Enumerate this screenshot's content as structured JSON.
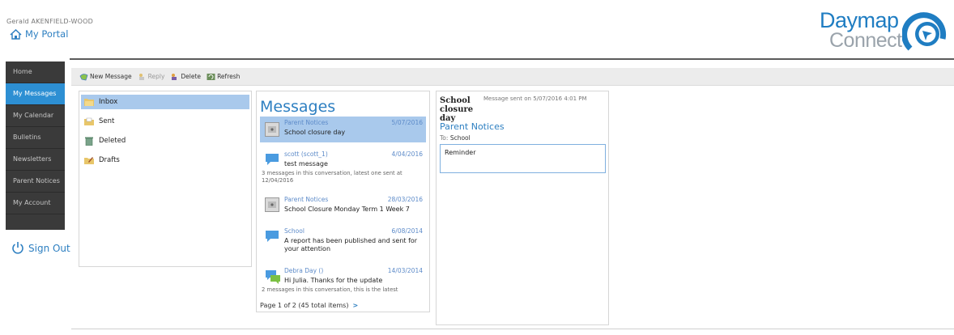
{
  "header": {
    "user_name": "Gerald AKENFIELD-WOOD",
    "portal_label": "My Portal",
    "brand_word1": "Daymap",
    "brand_word2": "Connect",
    "brand_color": "#1f7dc2"
  },
  "sidebar": {
    "items": [
      {
        "label": "Home",
        "active": false
      },
      {
        "label": "My Messages",
        "active": true
      },
      {
        "label": "My Calendar",
        "active": false
      },
      {
        "label": "Bulletins",
        "active": false
      },
      {
        "label": "Newsletters",
        "active": false
      },
      {
        "label": "Parent Notices",
        "active": false
      },
      {
        "label": "My Account",
        "active": false
      }
    ],
    "signout_label": "Sign Out",
    "active_color": "#2d8fd3"
  },
  "toolbar": {
    "new_message": "New Message",
    "reply": "Reply",
    "delete": "Delete",
    "refresh": "Refresh"
  },
  "folders": [
    {
      "label": "Inbox",
      "icon": "inbox-folder-icon"
    },
    {
      "label": "Sent",
      "icon": "sent-folder-icon"
    },
    {
      "label": "Deleted",
      "icon": "deleted-folder-icon"
    },
    {
      "label": "Drafts",
      "icon": "drafts-folder-icon"
    }
  ],
  "messages": {
    "title": "Messages",
    "items": [
      {
        "sender": "Parent Notices",
        "date": "5/07/2016",
        "subject": "School closure day",
        "meta": "",
        "icon": "notice-icon"
      },
      {
        "sender": "scott (scott_1)",
        "date": "4/04/2016",
        "subject": "test message",
        "meta": "3 messages in this conversation, latest one sent at 12/04/2016",
        "icon": "chat-bubble-icon"
      },
      {
        "sender": "Parent Notices",
        "date": "28/03/2016",
        "subject": "School Closure Monday Term 1 Week 7",
        "meta": "",
        "icon": "notice-icon"
      },
      {
        "sender": "School",
        "date": "6/08/2014",
        "subject": "A report has been published and sent for your attention",
        "meta": "",
        "icon": "chat-bubble-icon"
      },
      {
        "sender": "Debra Day ()",
        "date": "14/03/2014",
        "subject": "Hi Julia. Thanks for the update",
        "meta": "2 messages in this conversation, this is the latest",
        "icon": "conversation-icon"
      }
    ],
    "pager": "Page 1 of 2 (45 total items)",
    "pager_next": ">"
  },
  "detail": {
    "subject": "School closure day",
    "sent": "Message sent on 5/07/2016 4:01 PM",
    "from": "Parent Notices",
    "to_label": "To:",
    "to_value": "School",
    "body": "Reminder"
  }
}
